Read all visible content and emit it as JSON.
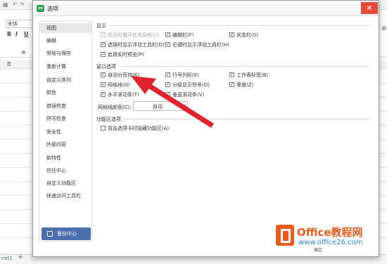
{
  "dialog": {
    "title": "选项",
    "close_glyph": "✕"
  },
  "app": {
    "font_name": "宋体",
    "bold": "B",
    "italic": "I",
    "underline": "U",
    "column_b": "B",
    "sheet_tab": "eet1",
    "add_sheet": "+"
  },
  "sidebar": {
    "items": [
      {
        "label": "视图"
      },
      {
        "label": "编辑"
      },
      {
        "label": "常规与保存"
      },
      {
        "label": "重新计算"
      },
      {
        "label": "自定义序列"
      },
      {
        "label": "颜色"
      },
      {
        "label": "错误检查"
      },
      {
        "label": "拼写检查"
      },
      {
        "label": "安全性"
      },
      {
        "label": "外部内容"
      },
      {
        "label": "新特性"
      },
      {
        "label": "信任中心"
      },
      {
        "label": "自定义功能区"
      },
      {
        "label": "快速访问工具栏"
      }
    ],
    "backup_label": "备份中心"
  },
  "display": {
    "title": "显示",
    "options": [
      {
        "label": "启动时展开任务窗格(U)",
        "checked": false,
        "disabled": true
      },
      {
        "label": "编辑栏(F)",
        "checked": true,
        "disabled": false
      },
      {
        "label": "状态栏(S)",
        "checked": true,
        "disabled": false
      },
      {
        "label": "选择时显示浮动工具栏(D)",
        "checked": true,
        "disabled": false
      },
      {
        "label": "右键时显示浮动工具栏(H)",
        "checked": true,
        "disabled": false
      },
      {
        "label": "启用实时预览(P)",
        "checked": true,
        "disabled": false
      }
    ]
  },
  "window_options": {
    "title": "窗口选项",
    "options": [
      {
        "label": "自动分页符(K)",
        "checked": true
      },
      {
        "label": "行号列标(E)",
        "checked": true
      },
      {
        "label": "工作表标签(B)",
        "checked": true
      },
      {
        "label": "网格线(G)",
        "checked": true
      },
      {
        "label": "分级显示符号(O)",
        "checked": true
      },
      {
        "label": "零值(Z)",
        "checked": true
      },
      {
        "label": "水平滚动条(T)",
        "checked": true
      },
      {
        "label": "垂直滚动条(V)",
        "checked": true
      }
    ],
    "gridline_color_label": "网格线颜色(C):",
    "gridline_color_value": "自动"
  },
  "ribbon": {
    "title": "功能区选项",
    "options": [
      {
        "label": "双击选项卡时隐藏功能区(A)",
        "checked": false
      }
    ]
  },
  "watermark": {
    "name": "Office教程网",
    "url": "www.office26.com",
    "ok_fragment": "确定"
  },
  "colors": {
    "close": "#e8483a",
    "backup": "#4b6fae",
    "arrow": "#e0242b",
    "watermark_orange": "#e85d1f",
    "watermark_blue": "#2a88d8"
  }
}
